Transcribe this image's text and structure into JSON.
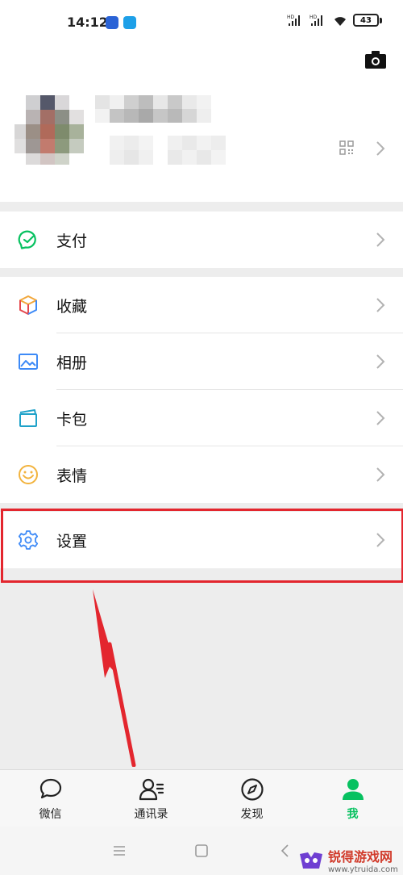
{
  "status_bar": {
    "time": "14:12",
    "battery": "43",
    "signal_labels": [
      "HD",
      "HD"
    ]
  },
  "profile": {
    "name": "",
    "wechat_id": ""
  },
  "menu": {
    "pay": "支付",
    "favorites": "收藏",
    "album": "相册",
    "cards": "卡包",
    "stickers": "表情",
    "settings": "设置"
  },
  "tabs": [
    {
      "label": "微信",
      "icon": "chat-bubble-icon",
      "active": false
    },
    {
      "label": "通讯录",
      "icon": "contacts-icon",
      "active": false
    },
    {
      "label": "发现",
      "icon": "compass-icon",
      "active": false
    },
    {
      "label": "我",
      "icon": "person-icon",
      "active": true
    }
  ],
  "colors": {
    "accent_green": "#07c160",
    "highlight_red": "#e3262e",
    "background": "#ededed"
  },
  "watermark": {
    "title": "锐得游戏网",
    "url": "www.ytruida.com"
  }
}
